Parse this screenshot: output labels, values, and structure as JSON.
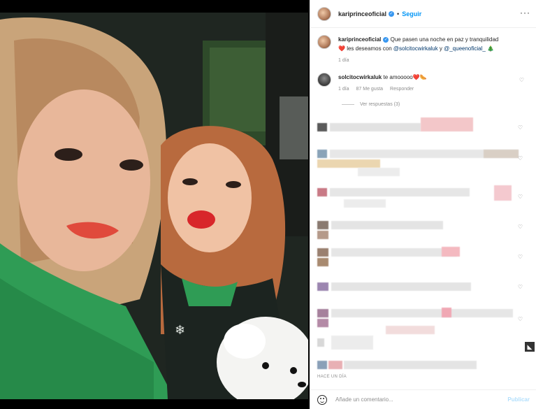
{
  "post": {
    "username": "kariprinceoficial",
    "dot": "•",
    "follow_label": "Seguir",
    "more_label": "···"
  },
  "caption": {
    "username": "kariprinceoficial",
    "text_part1": "Que pasen una noche en paz y tranquilidad",
    "heart": "❤️",
    "text_part2": "les deseamos con",
    "mention1": "@solcitocwirkaluk",
    "text_part3": "y",
    "mention2": "@_queenoficial_",
    "tree": "🎄",
    "time": "1 día"
  },
  "comments": [
    {
      "username": "solcitocwirkaluk",
      "text": "te amooooo",
      "emoji": "❤️🌭",
      "time": "1 día",
      "likes": "87 Me gusta",
      "reply": "Responder"
    }
  ],
  "replies_label": "Ver respuestas (3)",
  "timestamp_footer": "HACE UN DÍA",
  "footer": {
    "placeholder": "Añade un comentario...",
    "publish_label": "Publicar"
  },
  "icons": {
    "heart": "heart-icon",
    "emoji": "emoji-icon",
    "verified": "verified-icon"
  },
  "colors": {
    "link_blue": "#0095f6",
    "mention_blue": "#00376b",
    "verified_blue": "#3897f0",
    "muted_gray": "#8e8e8e"
  }
}
